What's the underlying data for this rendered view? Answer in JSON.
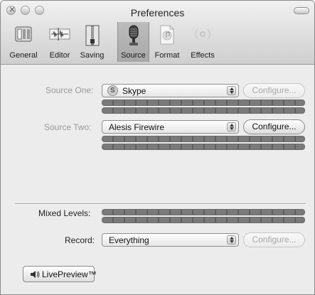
{
  "window": {
    "title": "Preferences"
  },
  "toolbar": {
    "items": [
      {
        "label": "General",
        "icon": "general-icon",
        "selected": false
      },
      {
        "label": "Editor",
        "icon": "editor-waveform-icon",
        "selected": false
      },
      {
        "label": "Saving",
        "icon": "saving-zipper-icon",
        "selected": false
      },
      {
        "label": "Source",
        "icon": "microphone-icon",
        "selected": true
      },
      {
        "label": "Format",
        "icon": "music-file-icon",
        "selected": false
      },
      {
        "label": "Effects",
        "icon": "effects-ripple-icon",
        "selected": false
      }
    ]
  },
  "source_one": {
    "label": "Source One:",
    "value": "Skype",
    "icon": "skype-icon",
    "configure": "Configure...",
    "configure_enabled": false
  },
  "source_two": {
    "label": "Source Two:",
    "value": "Alesis Firewire",
    "configure": "Configure...",
    "configure_enabled": true
  },
  "mixed_levels": {
    "label": "Mixed Levels:"
  },
  "record": {
    "label": "Record:",
    "value": "Everything",
    "configure": "Configure...",
    "configure_enabled": false
  },
  "live_preview": {
    "label": "LivePreview™",
    "icon": "speaker-icon"
  },
  "colors": {
    "toolbar_top": "#f1f1f1",
    "toolbar_bottom": "#cfcfcf",
    "background": "#ececec",
    "selected_tab": "#b0b0b0"
  }
}
